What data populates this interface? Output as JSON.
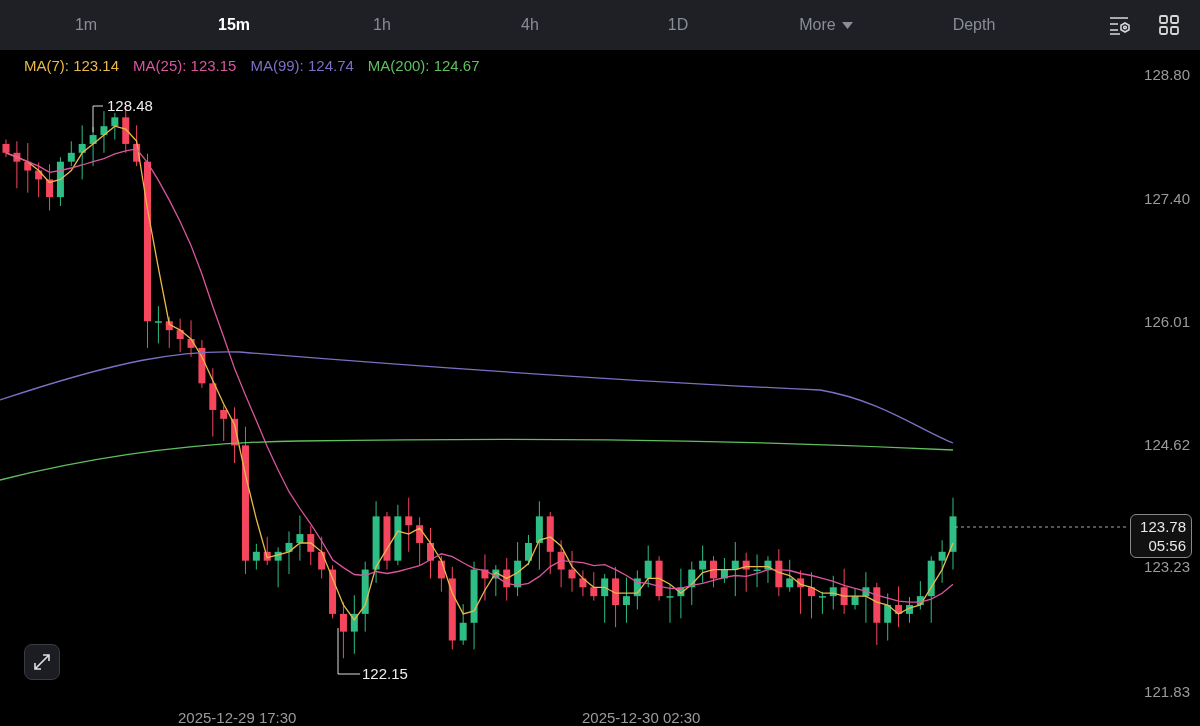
{
  "toolbar": {
    "tabs": [
      {
        "label": "1m",
        "selected": false
      },
      {
        "label": "15m",
        "selected": true
      },
      {
        "label": "1h",
        "selected": false
      },
      {
        "label": "4h",
        "selected": false
      },
      {
        "label": "1D",
        "selected": false
      },
      {
        "label": "More",
        "selected": false,
        "kind": "dropdown"
      },
      {
        "label": "Depth",
        "selected": false
      }
    ]
  },
  "legend": [
    {
      "label": "MA(7): 123.14",
      "color": "#e9b949"
    },
    {
      "label": "MA(25): 123.15",
      "color": "#d9559e"
    },
    {
      "label": "MA(99): 124.74",
      "color": "#7d6fc4"
    },
    {
      "label": "MA(200): 124.67",
      "color": "#5fbf5f"
    }
  ],
  "price_axis": [
    "128.80",
    "127.40",
    "126.01",
    "124.62",
    "123.23",
    "121.83"
  ],
  "time_axis": [
    "2025-12-29 17:30",
    "2025-12-30 02:30"
  ],
  "high_marker": "128.48",
  "low_marker": "122.15",
  "last_price": {
    "price": "123.78",
    "countdown": "05:56"
  }
}
